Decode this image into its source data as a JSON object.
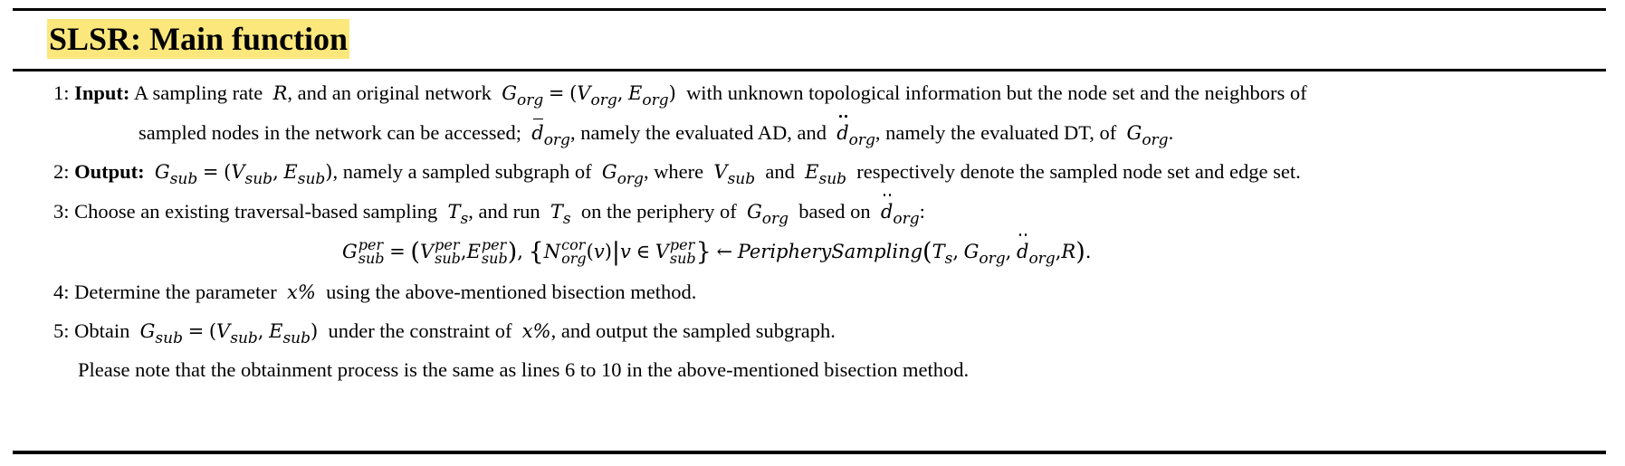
{
  "title": "SLSR: Main function",
  "lines": [
    {
      "num": "1:",
      "label": "Input:",
      "text_1": "A sampling rate",
      "text_2": ", and an original network",
      "text_3": "with unknown topological information but the node set and the neighbors of",
      "cont_1": "sampled nodes in the network can be accessed;",
      "cont_2": ", namely the evaluated AD, and",
      "cont_3": ", namely the evaluated DT, of",
      "cont_4": "."
    },
    {
      "num": "2:",
      "label": "Output:",
      "text_1": ", namely a sampled subgraph of",
      "text_2": ", where",
      "text_3": "and",
      "text_4": "respectively denote the sampled node set and edge set."
    },
    {
      "num": "3:",
      "text_1": "Choose an existing traversal-based sampling",
      "text_2": ", and run",
      "text_3": "on the periphery of",
      "text_4": "based on",
      "text_5": ":",
      "formula_fn": "PeripherySampling"
    },
    {
      "num": "4:",
      "text_1": "Determine the parameter",
      "text_2": "using the above-mentioned bisection method."
    },
    {
      "num": "5:",
      "text_1": "Obtain",
      "text_2": "under the constraint of",
      "text_3": ", and output the sampled subgraph.",
      "note": "Please note that the obtainment process is the same as lines 6 to 10 in the above-mentioned bisection method."
    }
  ],
  "symbols": {
    "R": "R",
    "G": "G",
    "V": "V",
    "E": "E",
    "d": "d",
    "T": "T",
    "N": "N",
    "v": "v",
    "s": "s",
    "org": "org",
    "sub": "sub",
    "per": "per",
    "cor": "cor",
    "x_pct": "x%"
  }
}
